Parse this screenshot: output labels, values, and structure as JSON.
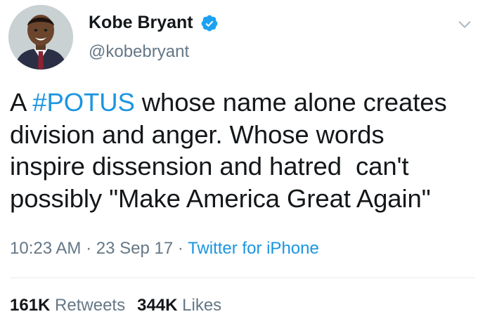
{
  "author": {
    "name": "Kobe Bryant",
    "handle": "@kobebryant",
    "verified": true,
    "avatar_icon": "profile-photo"
  },
  "tweet": {
    "text_prefix": "A ",
    "hashtag": "#POTUS",
    "text_rest": " whose name alone creates\ndivision and anger. Whose words\ninspire dissension and hatred  can't\npossibly \"Make America Great Again\""
  },
  "meta": {
    "time": "10:23 AM",
    "sep1": " · ",
    "date": "23 Sep 17",
    "sep2": " · ",
    "source": "Twitter for iPhone"
  },
  "stats": {
    "retweets_count": "161K",
    "retweets_label": "Retweets",
    "likes_count": "344K",
    "likes_label": "Likes"
  },
  "colors": {
    "link": "#1b95e0",
    "secondary": "#657786",
    "primary": "#14171a",
    "verified": "#1da1f2"
  },
  "icons": {
    "verified": "verified-badge-icon",
    "menu": "chevron-down-icon"
  }
}
